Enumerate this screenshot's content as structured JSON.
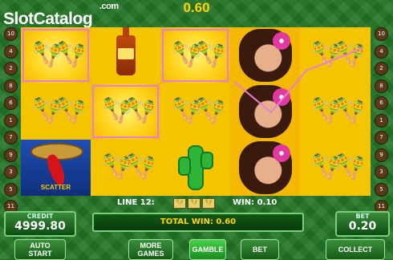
{
  "header": {
    "logo_main": "SlotCatalog",
    "logo_suffix": ".com",
    "win_amount": "0.60"
  },
  "lines_left": [
    "10",
    "4",
    "2",
    "8",
    "6",
    "1",
    "7",
    "9",
    "3",
    "5",
    "11"
  ],
  "lines_right": [
    "10",
    "4",
    "2",
    "8",
    "6",
    "1",
    "7",
    "9",
    "3",
    "5",
    "11"
  ],
  "reels": {
    "r1": [
      "maracas",
      "maracas",
      "scatter"
    ],
    "r2": [
      "tequila",
      "maracas",
      "maracas"
    ],
    "r3": [
      "maracas",
      "maracas",
      "cactus"
    ],
    "r4": [
      "woman",
      "woman",
      "woman"
    ],
    "r5": [
      "maracas",
      "maracas",
      "maracas"
    ],
    "scatter_label": "SCATTER"
  },
  "info": {
    "line_label": "LINE 12:",
    "win_label": "WIN: 0.10"
  },
  "credit": {
    "caption": "CREDIT",
    "value": "4999.80"
  },
  "bet": {
    "caption": "BET",
    "value": "0.20"
  },
  "total_win": "TOTAL WIN: 0.60",
  "buttons": {
    "auto_line1": "AUTO",
    "auto_line2": "START",
    "more_line1": "MORE",
    "more_line2": "GAMES",
    "gamble": "GAMBLE",
    "bet": "BET",
    "collect": "COLLECT"
  },
  "colors": {
    "accent": "#ffd400",
    "reel_bg": "#f5c400",
    "highlight": "#e87fd7",
    "table_green": "#237526"
  }
}
